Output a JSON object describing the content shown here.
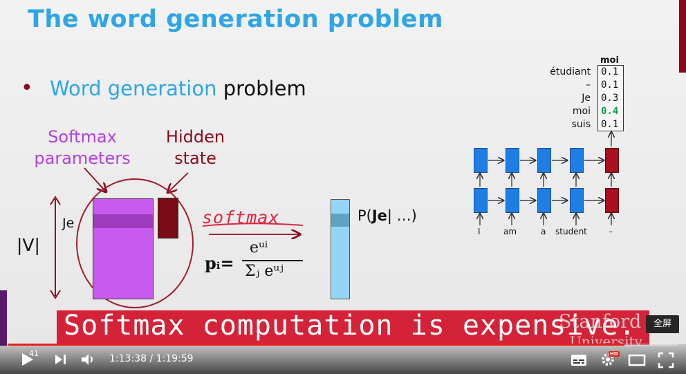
{
  "slide": {
    "title": "The word generation problem",
    "bullet_mark": "•",
    "bullet_hl": "Word generation",
    "bullet_rest": " problem",
    "softmax_params_line1": "Softmax",
    "softmax_params_line2": "parameters",
    "hidden_state_line1": "Hidden",
    "hidden_state_line2": "state",
    "je_label": "Je",
    "v_label": "|V|",
    "softmax_word": "softmax",
    "formula_p": "pᵢ=",
    "formula_num": "eᵘⁱ",
    "formula_den": "Σⱼ eᵘʲ",
    "pje_prefix": "P(",
    "pje_bold": "Je",
    "pje_suffix": "| …)",
    "prob_header": "moi",
    "prob_words": [
      "étudiant",
      "–",
      "Je",
      "moi",
      "suis"
    ],
    "prob_values": [
      "0.1",
      "0.1",
      "0.3",
      "0.4",
      "0.1"
    ],
    "rnn_inputs": [
      "I",
      "am",
      "a",
      "student",
      "–"
    ]
  },
  "subtitle": {
    "text": "Softmax computation is expensive.",
    "watermark_line1": "Stanford",
    "watermark_line2": "University"
  },
  "tooltip": {
    "fullscreen": "全屏"
  },
  "player": {
    "time_display": "1:13:38 / 1:19:59",
    "thumb_number": "41",
    "progress": 0.92,
    "accent": "#e62117",
    "hd_badge": "HD"
  },
  "icons": [
    "play-icon",
    "next-icon",
    "volume-icon",
    "subtitles-icon",
    "settings-icon",
    "theater-icon",
    "fullscreen-icon"
  ]
}
